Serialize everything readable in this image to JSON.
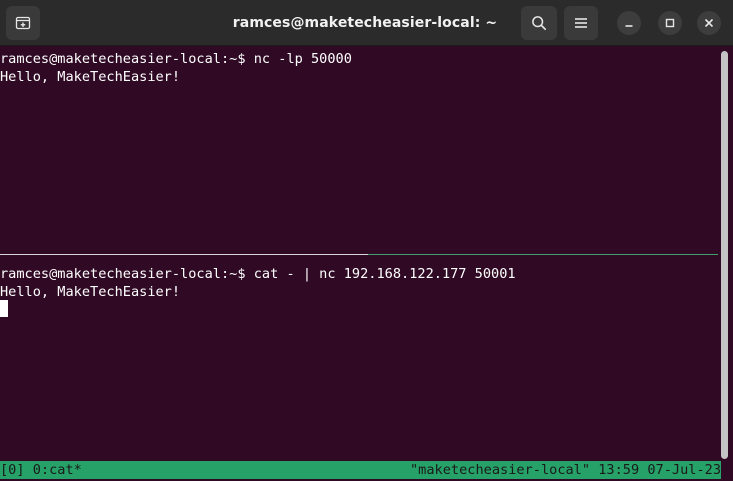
{
  "window": {
    "title": "ramces@maketecheasier-local: ~"
  },
  "headerbar": {
    "icons": {
      "new_tab": "new-tab-icon",
      "search": "search-icon",
      "menu": "hamburger-menu-icon",
      "minimize": "minimize-icon",
      "maximize": "maximize-icon",
      "close": "close-icon"
    }
  },
  "panes": {
    "top": {
      "lines": [
        "ramces@maketecheasier-local:~$ nc -lp 50000",
        "Hello, MakeTechEasier!"
      ]
    },
    "bottom": {
      "lines": [
        "ramces@maketecheasier-local:~$ cat - | nc 192.168.122.177 50001",
        "Hello, MakeTechEasier!"
      ]
    }
  },
  "tmux_status": {
    "left": "[0] 0:cat*",
    "right": "\"maketecheasier-local\" 13:59 07-Jul-23"
  },
  "colors": {
    "terminal_background": "#300a24",
    "status_bar": "#26a269",
    "active_pane_border": "#3f9e6a",
    "headerbar": "#2b2b2b"
  }
}
